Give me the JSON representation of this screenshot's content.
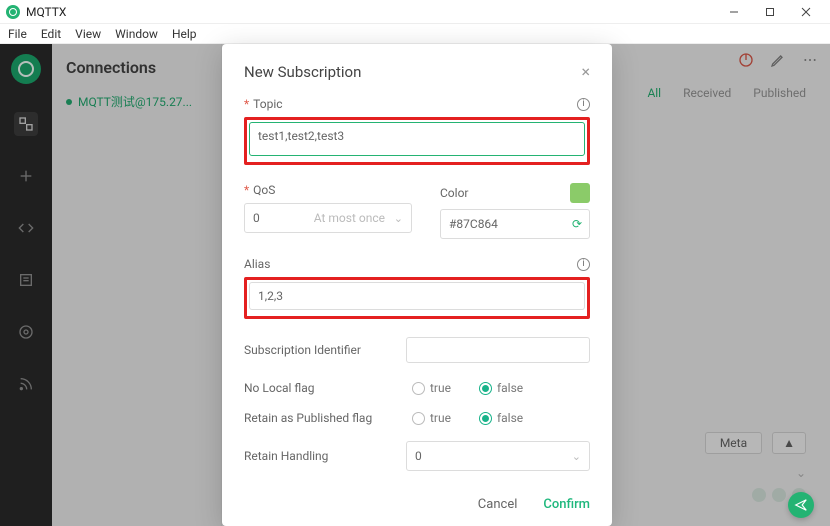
{
  "window": {
    "title": "MQTTX"
  },
  "menu": [
    "File",
    "Edit",
    "View",
    "Window",
    "Help"
  ],
  "sidebar": {
    "header": "Connections",
    "connection": "MQTT测试@175.27..."
  },
  "main": {
    "filters": {
      "all": "All",
      "received": "Received",
      "published": "Published"
    },
    "meta_button": "Meta"
  },
  "dialog": {
    "title": "New Subscription",
    "topic_label": "Topic",
    "topic_value": "test1,test2,test3",
    "qos_label": "QoS",
    "qos_value": "0",
    "qos_hint": "At most once",
    "color_label": "Color",
    "color_value": "#87C864",
    "alias_label": "Alias",
    "alias_value": "1,2,3",
    "sub_id_label": "Subscription Identifier",
    "no_local_label": "No Local flag",
    "retain_pub_label": "Retain as Published flag",
    "retain_handling_label": "Retain Handling",
    "retain_handling_value": "0",
    "true": "true",
    "false": "false",
    "cancel": "Cancel",
    "confirm": "Confirm"
  }
}
